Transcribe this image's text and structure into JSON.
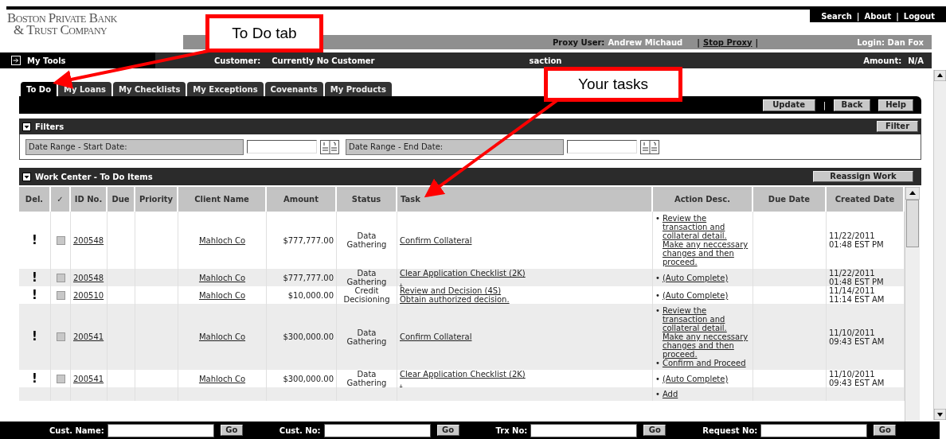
{
  "logo": {
    "line1": "Boston Private Bank",
    "line2": "& Trust Company"
  },
  "top_links": [
    {
      "label": "Search"
    },
    {
      "separator": "|",
      "label": "About"
    },
    {
      "separator": "|",
      "label": "Logout"
    }
  ],
  "proxy_bar": {
    "proxy_label": "Proxy User:",
    "proxy_user": "Andrew Michaud",
    "separator_1": "|",
    "stop_link": "Stop Proxy",
    "separator_2": "|",
    "login": "Login: Dan Fox"
  },
  "info_bar": {
    "tools": "My Tools",
    "customer_label": "Customer:",
    "customer_value": "Currently No Customer",
    "transaction_label": "saction",
    "amount_label": "Amount:",
    "amount_value": "N/A"
  },
  "tabs": [
    {
      "label": "To Do",
      "selected": true
    },
    {
      "label": "My Loans",
      "selected": false
    },
    {
      "label": "My Checklists",
      "selected": false
    },
    {
      "label": "My Exceptions",
      "selected": false
    },
    {
      "label": "Covenants",
      "selected": false
    },
    {
      "label": "My Products",
      "selected": false
    }
  ],
  "toolbar": {
    "buttons": [
      "Update",
      "Back",
      "Help"
    ],
    "separator": "|"
  },
  "filters": {
    "title": "Filters",
    "button": "Filter",
    "fields": [
      {
        "label": "Date Range - Start Date:"
      },
      {
        "label": "Date Range - End Date:"
      }
    ]
  },
  "work_center": {
    "title": "Work Center - To Do Items",
    "button": "Reassign Work",
    "columns": [
      "Del.",
      "✓",
      "ID No.",
      "Due",
      "Priority",
      "Client Name",
      "Amount",
      "Status",
      "Task",
      "Action Desc.",
      "Due Date",
      "Created Date"
    ],
    "rows": [
      {
        "flag": "!",
        "checked": false,
        "id": "200548",
        "client": "Mahloch Co",
        "amount": "$777,777.00",
        "status": "Data Gathering",
        "task": [
          "Confirm Collateral"
        ],
        "actions": [
          {
            "bullet": "•",
            "text": "Review the transaction and collateral detail. Make any neccessary changes and then proceed."
          }
        ],
        "created": "11/22/2011 01:48 EST PM"
      },
      {
        "flag": "!",
        "checked": false,
        "id": "200548",
        "client": "Mahloch Co",
        "amount": "$777,777.00",
        "status": "Data Gathering",
        "task": [
          "Clear Application Checklist (2K)",
          "."
        ],
        "actions": [
          {
            "bullet": "•",
            "text": "(Auto Complete)"
          }
        ],
        "created": "11/22/2011 01:48 EST PM"
      },
      {
        "flag": "!",
        "checked": false,
        "id": "200510",
        "client": "Mahloch Co",
        "amount": "$10,000.00",
        "status": "Credit Decisioning",
        "task": [
          "Review and Decision (4S)",
          "Obtain authorized decision."
        ],
        "actions": [
          {
            "bullet": "•",
            "text": "(Auto Complete)"
          }
        ],
        "created": "11/14/2011 11:14 EST AM"
      },
      {
        "flag": "!",
        "checked": false,
        "id": "200541",
        "client": "Mahloch Co",
        "amount": "$300,000.00",
        "status": "Data Gathering",
        "task": [
          "Confirm Collateral"
        ],
        "actions": [
          {
            "bullet": "•",
            "text": "Review the transaction and collateral detail. Make any neccessary changes and then proceed."
          },
          {
            "bullet": "•",
            "text": "Confirm and Proceed"
          }
        ],
        "created": "11/10/2011 09:43 EST AM"
      },
      {
        "flag": "!",
        "checked": false,
        "id": "200541",
        "client": "Mahloch Co",
        "amount": "$300,000.00",
        "status": "Data Gathering",
        "task": [
          "Clear Application Checklist (2K)",
          "."
        ],
        "actions": [
          {
            "bullet": "•",
            "text": "(Auto Complete)"
          }
        ],
        "created": "11/10/2011 09:43 EST AM"
      },
      {
        "actions": [
          {
            "bullet": "•",
            "text": "Add"
          }
        ]
      }
    ]
  },
  "bottom_search": [
    {
      "label": "Cust. Name:",
      "button": "Go"
    },
    {
      "label": "Cust. No:",
      "button": "Go"
    },
    {
      "label": "Trx No:",
      "button": "Go"
    },
    {
      "label": "Request No:",
      "button": "Go"
    }
  ],
  "callouts": [
    {
      "text": "To Do tab"
    },
    {
      "text": "Your tasks"
    }
  ]
}
